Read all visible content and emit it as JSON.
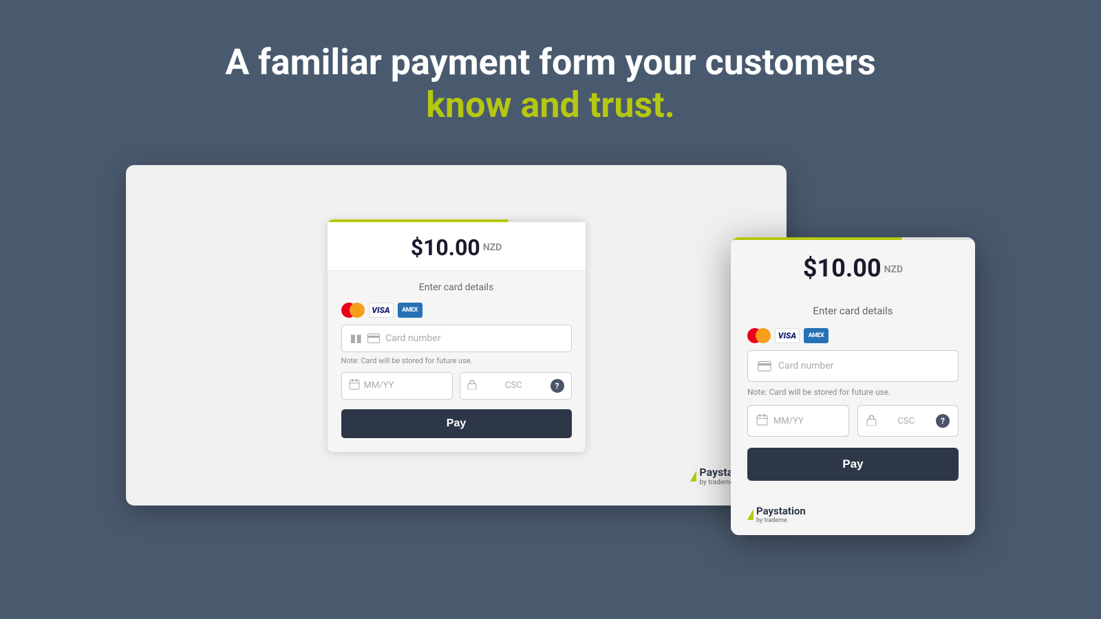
{
  "page": {
    "bg_color": "#4a5a6e"
  },
  "headline": {
    "line1": "A familiar payment form your customers",
    "line2": "know and trust.",
    "line2_color": "#b5c811"
  },
  "desktop_widget": {
    "top_bar_accent": "#b5c811",
    "amount": "$10.00",
    "currency": "NZD",
    "enter_card_details_label": "Enter card details",
    "card_number_placeholder": "Card number",
    "card_note": "Note: Card will be stored for future use.",
    "expiry_placeholder": "MM/YY",
    "csc_placeholder": "CSC",
    "pay_button_label": "Pay",
    "paystation_label": "Paystation",
    "paystation_sublabel": "by trademe"
  },
  "mobile_widget": {
    "top_bar_accent": "#b5c811",
    "amount": "$10.00",
    "currency": "NZD",
    "enter_card_details_label": "Enter card details",
    "card_number_placeholder": "Card number",
    "card_note": "Note: Card will be stored for future use.",
    "expiry_placeholder": "MM/YY",
    "csc_placeholder": "CSC",
    "pay_button_label": "Pay",
    "paystation_label": "Paystation",
    "paystation_sublabel": "by trademe"
  },
  "icons": {
    "mastercard": "mastercard-icon",
    "visa": "VISA",
    "amex": "AMEX",
    "help": "?"
  }
}
